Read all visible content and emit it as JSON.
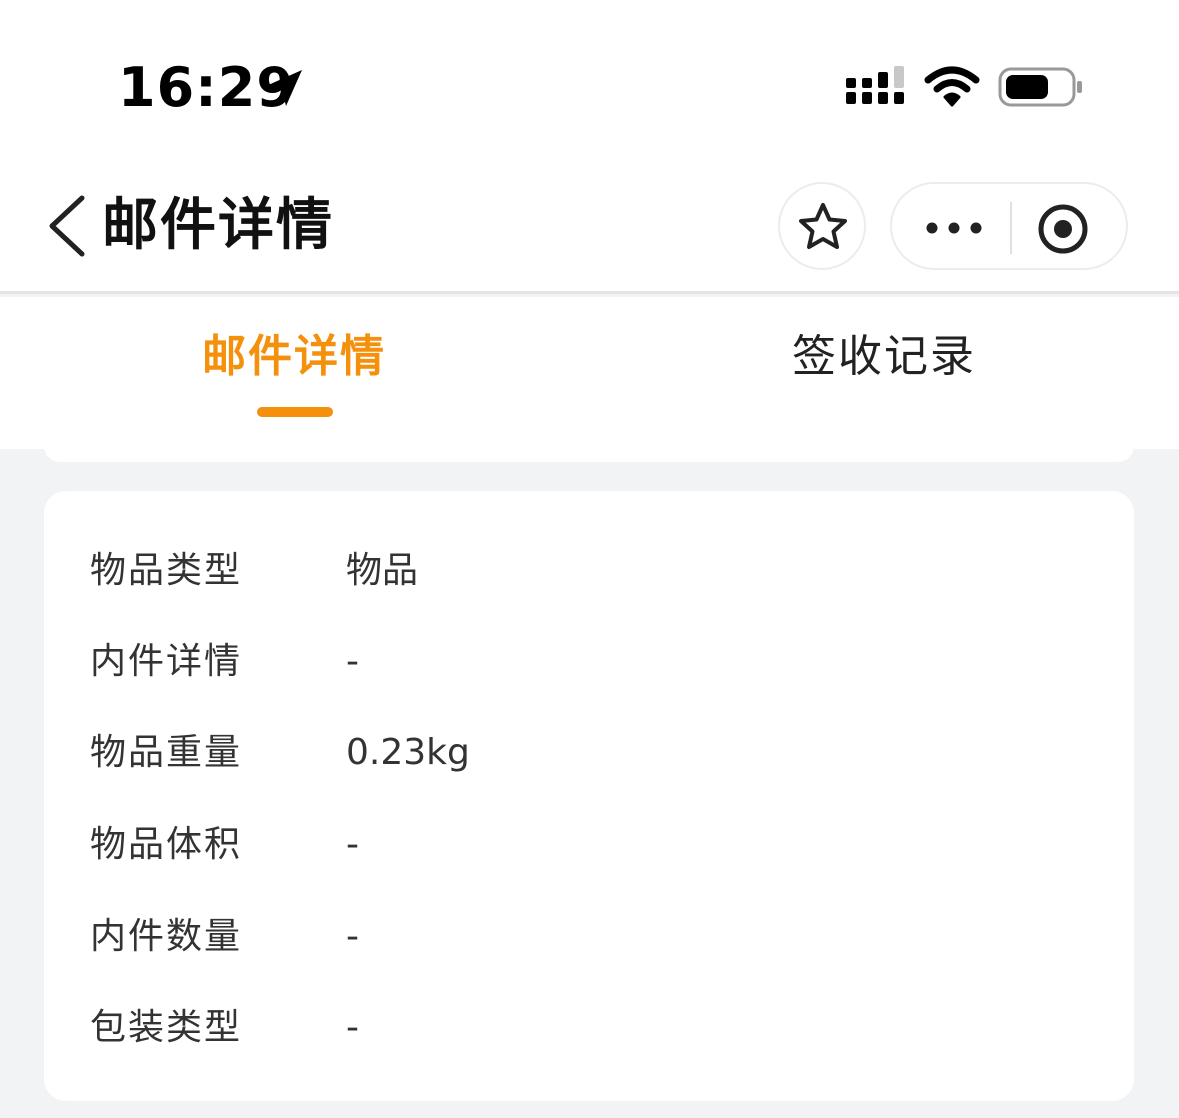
{
  "status_bar": {
    "time": "16:29",
    "icons": [
      "location-arrow-icon",
      "cellular-signal-icon",
      "wifi-icon",
      "battery-icon"
    ]
  },
  "nav": {
    "title": "邮件详情",
    "icons": [
      "back-chevron-icon",
      "star-icon",
      "more-dots-icon",
      "close-target-icon"
    ]
  },
  "tabs": [
    {
      "label": "邮件详情",
      "active": true
    },
    {
      "label": "签收记录",
      "active": false
    }
  ],
  "details": [
    {
      "label": "物品类型",
      "value": "物品"
    },
    {
      "label": "内件详情",
      "value": "-"
    },
    {
      "label": "物品重量",
      "value": "0.23kg"
    },
    {
      "label": "物品体积",
      "value": "-"
    },
    {
      "label": "内件数量",
      "value": "-"
    },
    {
      "label": "包装类型",
      "value": "-"
    }
  ],
  "colors": {
    "accent": "#f5900c",
    "background": "#f2f3f5",
    "text": "#333333"
  }
}
